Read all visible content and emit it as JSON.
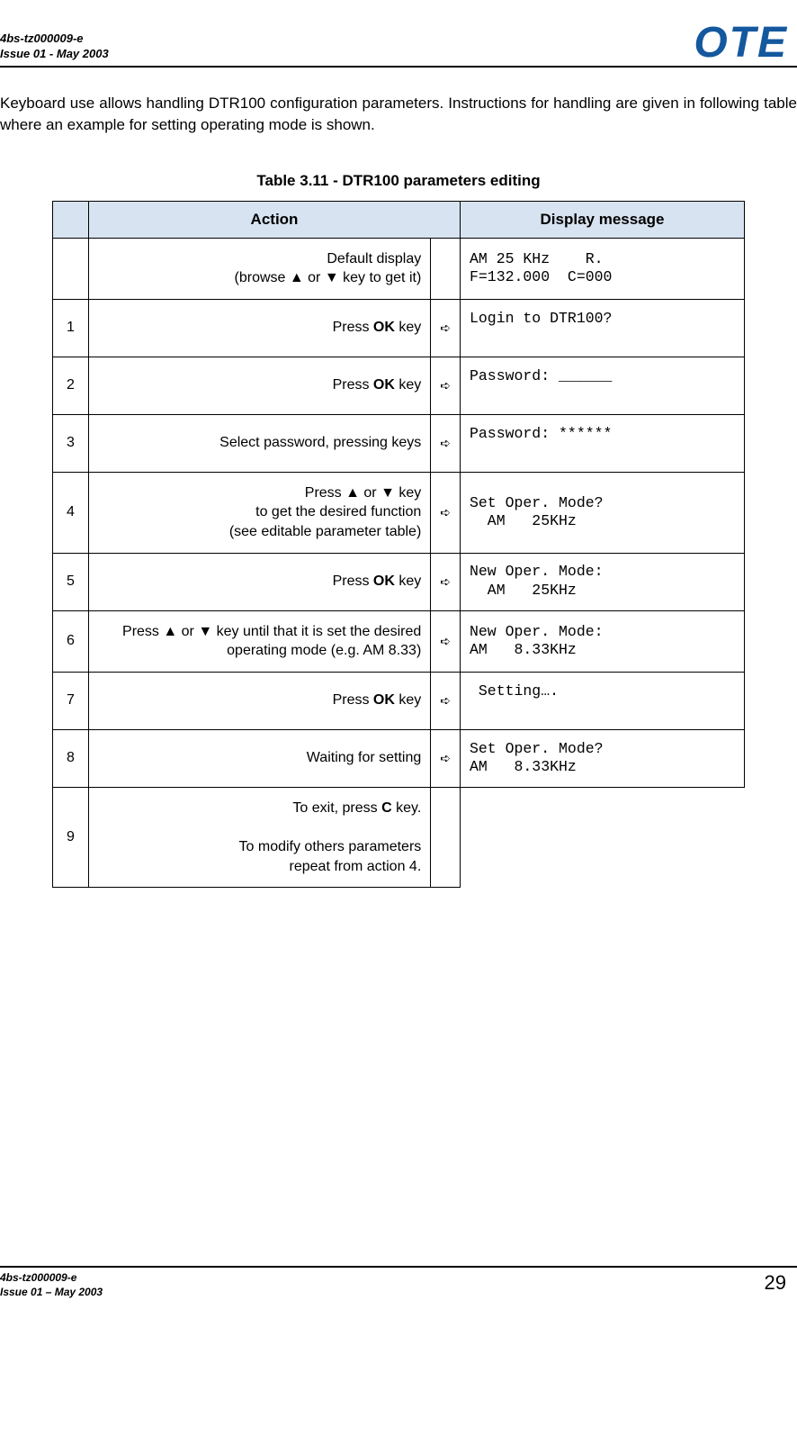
{
  "header": {
    "docid": "4bs-tz000009-e",
    "issue": "Issue 01 - May 2003",
    "logo": "OTE"
  },
  "intro": "Keyboard use allows handling DTR100 configuration parameters.  Instructions for handling are given in following table where an example for setting operating mode is shown.",
  "table": {
    "title": "Table 3.11 - DTR100 parameters editing",
    "headers": {
      "action": "Action",
      "display": "Display message"
    },
    "rows": [
      {
        "step": "",
        "action_pre": "Default display\n(browse ",
        "action_mid": "▲ or ▼",
        "action_post": " key to get it)",
        "ok": false,
        "arrow": "",
        "display": "AM 25 KHz    R.\nF=132.000  C=000",
        "has_display": true
      },
      {
        "step": "1",
        "action_pre": "Press  ",
        "action_bold": "OK",
        "action_post": "  key",
        "arrow": "➪",
        "display": "Login to DTR100?\n ",
        "has_display": true
      },
      {
        "step": "2",
        "action_pre": "Press  ",
        "action_bold": "OK",
        "action_post": "  key",
        "arrow": "➪",
        "display": "Password: ______\n ",
        "has_display": true
      },
      {
        "step": "3",
        "action_pre": "Select password, pressing keys",
        "arrow": "➪",
        "display": "Password: ******\n ",
        "has_display": true
      },
      {
        "step": "4",
        "action_pre": "Press ▲ or ▼ key\nto get the desired function\n(see editable parameter table)",
        "arrow": "➪",
        "display": "Set Oper. Mode?\n  AM   25KHz",
        "has_display": true
      },
      {
        "step": "5",
        "action_pre": "Press  ",
        "action_bold": "OK",
        "action_post": "  key",
        "arrow": "➪",
        "display": "New Oper. Mode:\n  AM   25KHz",
        "has_display": true
      },
      {
        "step": "6",
        "action_pre": "Press ▲ or ▼ key until that it is set the desired operating mode (e.g. AM 8.33)",
        "arrow": "➪",
        "display": "New Oper. Mode:\nAM   8.33KHz",
        "has_display": true
      },
      {
        "step": "7",
        "action_pre": "Press  ",
        "action_bold": "OK",
        "action_post": "  key",
        "arrow": "➪",
        "display": " Setting….\n ",
        "has_display": true
      },
      {
        "step": "8",
        "action_pre": "Waiting for setting",
        "arrow": "➪",
        "display": "Set Oper. Mode?\nAM   8.33KHz",
        "has_display": true
      },
      {
        "step": "9",
        "action_pre": "To exit, press  ",
        "action_bold": "C",
        "action_post": "  key.\n\nTo modify others parameters\nrepeat from action 4.",
        "arrow": "",
        "display": "",
        "has_display": false
      }
    ]
  },
  "footer": {
    "docid": "4bs-tz000009-e",
    "issue": "Issue 01 – May 2003",
    "page": "29"
  }
}
